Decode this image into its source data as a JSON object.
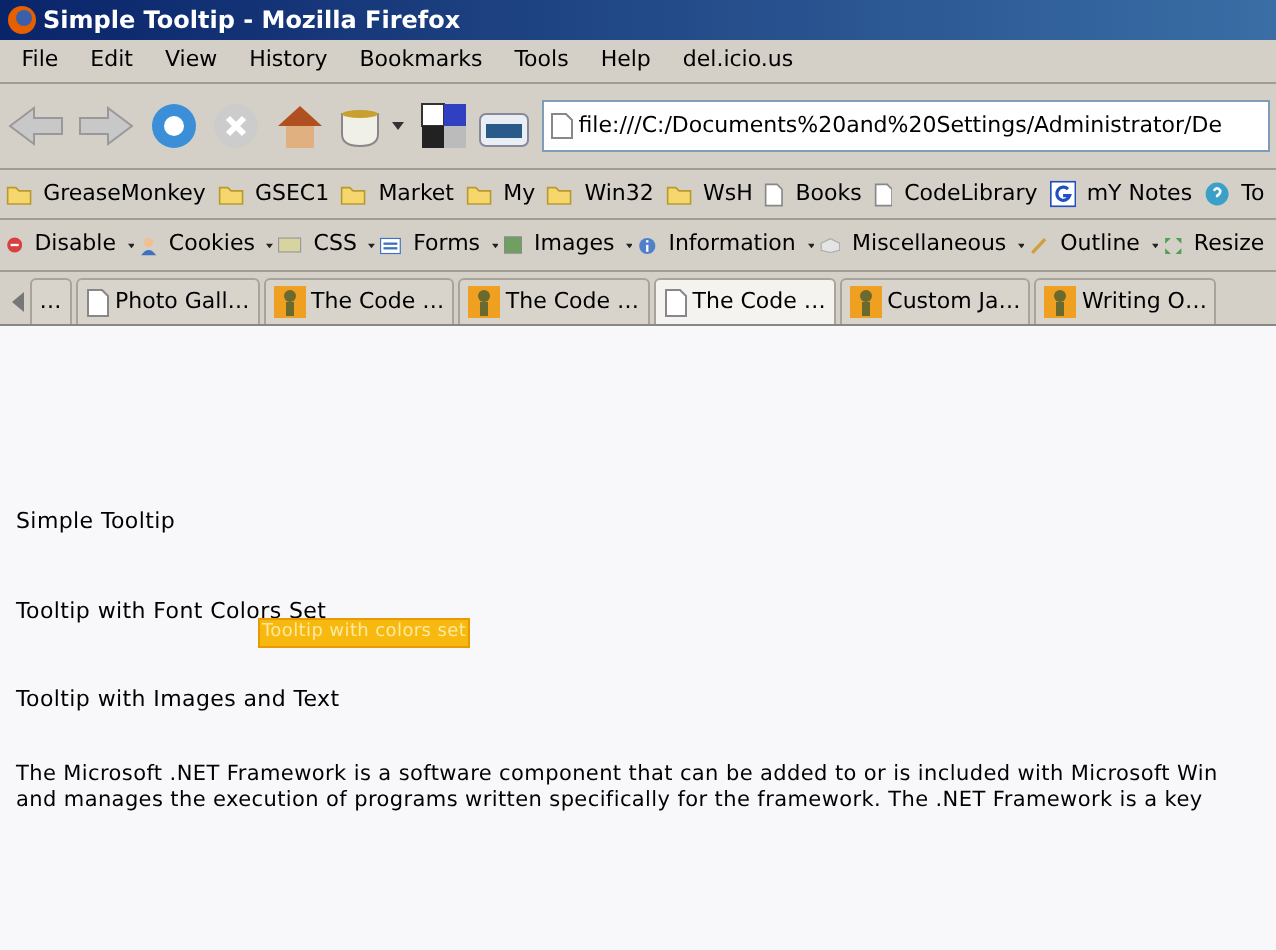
{
  "window": {
    "title": "Simple Tooltip - Mozilla Firefox"
  },
  "menu": [
    "File",
    "Edit",
    "View",
    "History",
    "Bookmarks",
    "Tools",
    "Help",
    "del.icio.us"
  ],
  "address": {
    "value": "file:///C:/Documents%20and%20Settings/Administrator/De"
  },
  "bookmarks": [
    {
      "kind": "folder",
      "label": "GreaseMonkey"
    },
    {
      "kind": "folder",
      "label": "GSEC1"
    },
    {
      "kind": "folder",
      "label": "Market"
    },
    {
      "kind": "folder",
      "label": "My"
    },
    {
      "kind": "folder",
      "label": "Win32"
    },
    {
      "kind": "folder",
      "label": "WsH"
    },
    {
      "kind": "page",
      "label": "Books"
    },
    {
      "kind": "page",
      "label": "CodeLibrary"
    },
    {
      "kind": "google",
      "label": "mY Notes"
    },
    {
      "kind": "help",
      "label": "To"
    }
  ],
  "dev_toolbar": [
    {
      "kind": "disable",
      "label": "Disable"
    },
    {
      "kind": "cookies",
      "label": "Cookies"
    },
    {
      "kind": "css",
      "label": "CSS"
    },
    {
      "kind": "forms",
      "label": "Forms"
    },
    {
      "kind": "images",
      "label": "Images"
    },
    {
      "kind": "info",
      "label": "Information"
    },
    {
      "kind": "misc",
      "label": "Miscellaneous"
    },
    {
      "kind": "outline",
      "label": "Outline"
    },
    {
      "kind": "resize",
      "label": "Resize"
    }
  ],
  "tabs": [
    {
      "kind": "none",
      "label": "…",
      "selected": false
    },
    {
      "kind": "page",
      "label": "Photo Gall…",
      "selected": false
    },
    {
      "kind": "bot",
      "label": "The Code …",
      "selected": false
    },
    {
      "kind": "bot",
      "label": "The Code …",
      "selected": false
    },
    {
      "kind": "page",
      "label": "The Code …",
      "selected": true
    },
    {
      "kind": "bot",
      "label": "Custom Ja…",
      "selected": false
    },
    {
      "kind": "bot",
      "label": "Writing O…",
      "selected": false
    }
  ],
  "content": {
    "headings": [
      "Simple Tooltip",
      "Tooltip with Font Colors Set",
      "Tooltip with Images and Text"
    ],
    "tooltip": {
      "text": "Tooltip with colors set"
    },
    "paragraph_lines": [
      "The Microsoft .NET Framework is a software component that can be added to or is included with Microsoft Win",
      "and manages the execution of programs written specifically for the framework. The .NET Framework is a key"
    ]
  }
}
